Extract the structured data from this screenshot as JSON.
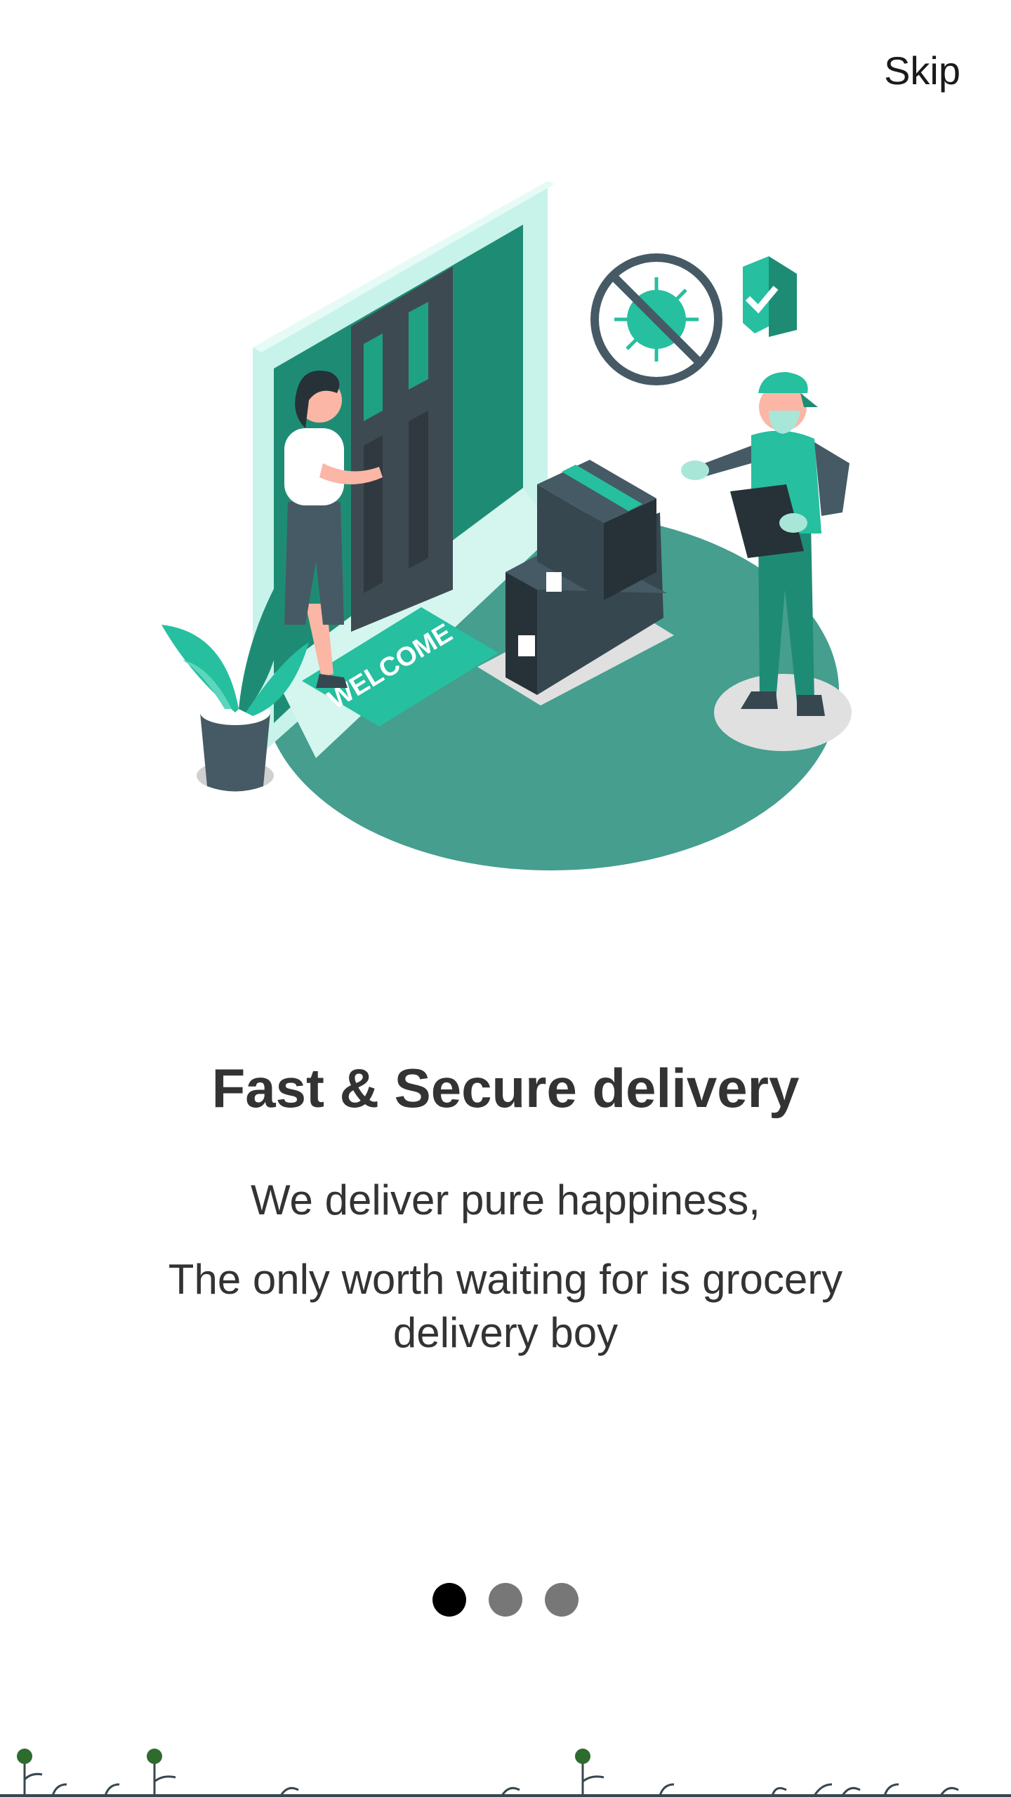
{
  "header": {
    "skip_label": "Skip"
  },
  "illustration": {
    "mat_text": "WELCOME"
  },
  "content": {
    "title": "Fast & Secure delivery",
    "subtitle": "We deliver pure happiness,",
    "description": "The only worth waiting for is grocery delivery boy"
  },
  "pager": {
    "total": 3,
    "active_index": 0
  },
  "colors": {
    "primary": "#26BFA0",
    "dark_teal": "#1E8C74",
    "floor": "#459E8E",
    "dark": "#37474F",
    "text": "#333333",
    "dot_active": "#000000",
    "dot_inactive": "#777777"
  }
}
